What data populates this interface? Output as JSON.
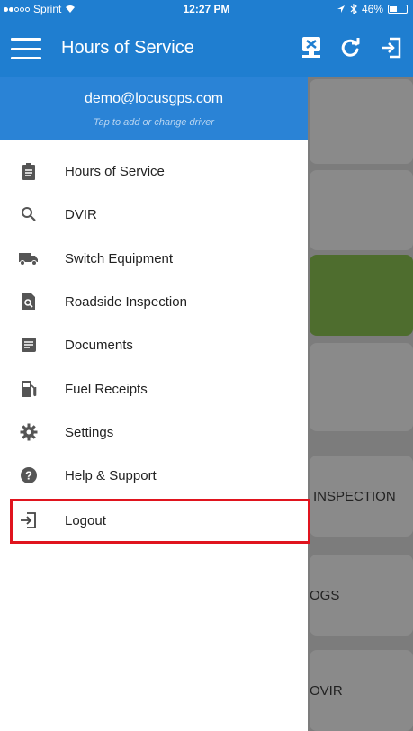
{
  "status_bar": {
    "carrier": "Sprint",
    "time": "12:27 PM",
    "battery": "46%",
    "battery_level": 0.46
  },
  "app_bar": {
    "title": "Hours of Service",
    "icons": [
      "menu-icon",
      "report-icon",
      "refresh-icon",
      "login-icon"
    ]
  },
  "drawer": {
    "email": "demo@locusgps.com",
    "subtitle": "Tap to add or change driver",
    "items": [
      {
        "label": "Hours of Service",
        "icon": "clipboard-icon"
      },
      {
        "label": "DVIR",
        "icon": "search-icon"
      },
      {
        "label": "Switch Equipment",
        "icon": "truck-icon"
      },
      {
        "label": "Roadside Inspection",
        "icon": "inspection-icon"
      },
      {
        "label": "Documents",
        "icon": "document-icon"
      },
      {
        "label": "Fuel Receipts",
        "icon": "fuel-icon"
      },
      {
        "label": "Settings",
        "icon": "gear-icon"
      },
      {
        "label": "Help & Support",
        "icon": "help-icon"
      },
      {
        "label": "Logout",
        "icon": "logout-icon"
      }
    ]
  },
  "background_cards": [
    {
      "label": "INSPECTION"
    },
    {
      "label": "OGS"
    },
    {
      "label": "OVIR"
    }
  ],
  "colors": {
    "primary": "#1f7ed0",
    "header": "#2a83d6",
    "highlight": "#e0141e",
    "overlay": "#7c7c7c"
  }
}
